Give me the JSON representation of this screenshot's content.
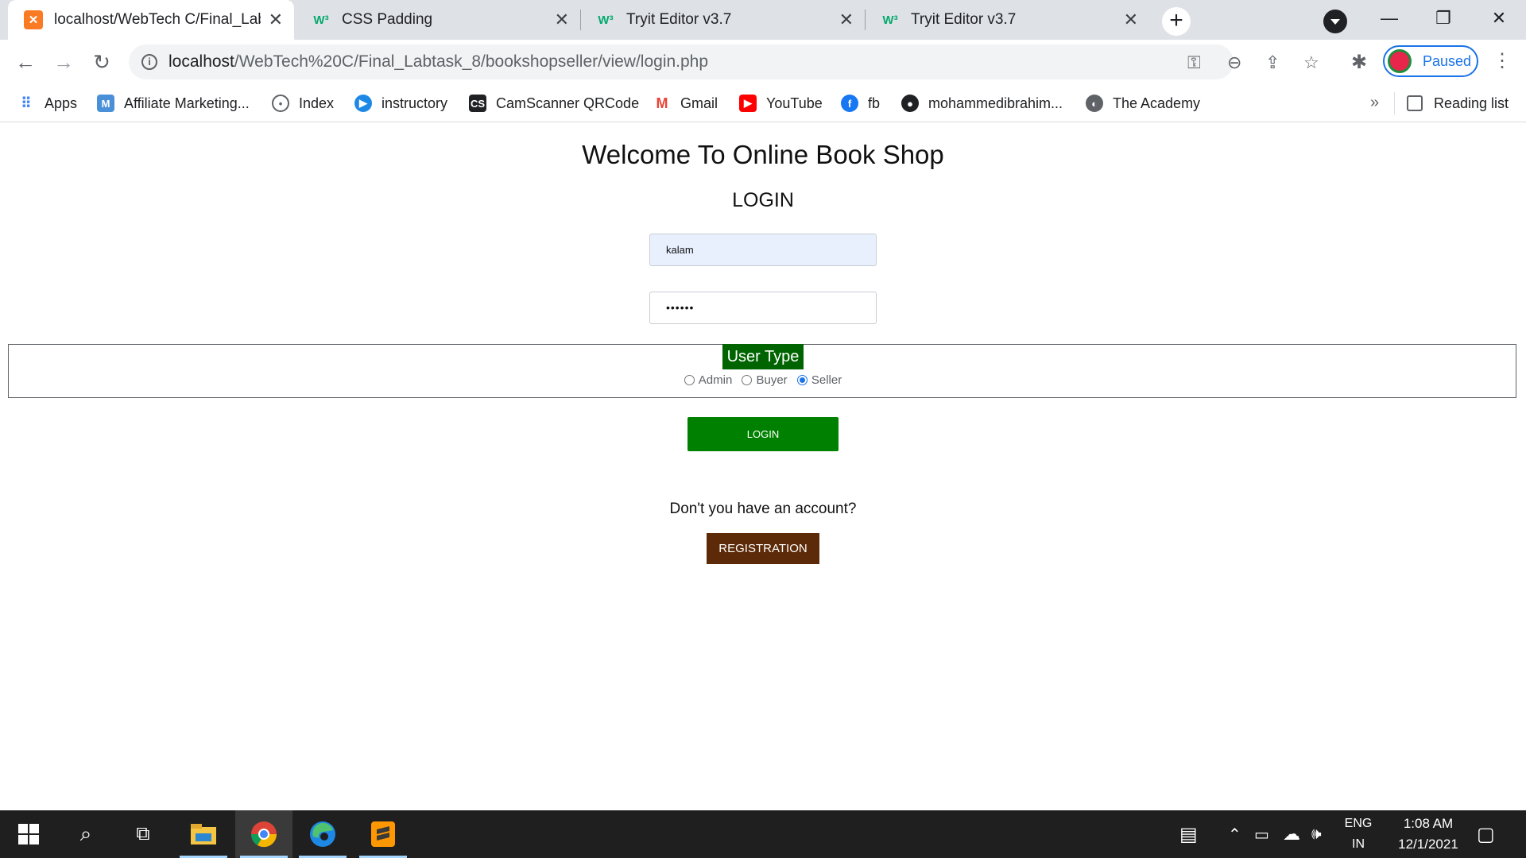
{
  "browser": {
    "tabs": [
      {
        "title": "localhost/WebTech C/Final_Labta",
        "active": true,
        "favicon": "xampp-icon"
      },
      {
        "title": "CSS Padding",
        "active": false,
        "favicon": "w3schools-icon"
      },
      {
        "title": "Tryit Editor v3.7",
        "active": false,
        "favicon": "w3schools-icon"
      },
      {
        "title": "Tryit Editor v3.7",
        "active": false,
        "favicon": "w3schools-icon"
      }
    ],
    "url_host": "localhost",
    "url_path": "/WebTech%20C/Final_Labtask_8/bookshopseller/view/login.php",
    "profile_label": "Paused",
    "bookmarks": [
      "Apps",
      "Affiliate Marketing...",
      "Index",
      "instructory",
      "CamScanner QRCode",
      "Gmail",
      "YouTube",
      "fb",
      "mohammedibrahim...",
      "The Academy"
    ],
    "reading_list": "Reading list"
  },
  "page": {
    "title": "Welcome To Online Book Shop",
    "login_heading": "LOGIN",
    "username_value": "kalam",
    "password_value": "••••••",
    "user_type_legend": "User Type",
    "user_types": [
      {
        "label": "Admin",
        "checked": false
      },
      {
        "label": "Buyer",
        "checked": false
      },
      {
        "label": "Seller",
        "checked": true
      }
    ],
    "login_button": "LOGIN",
    "account_question": "Don't you have an account?",
    "registration_button": "REGISTRATION"
  },
  "colors": {
    "legend_bg": "#006400",
    "login_btn": "#008000",
    "registration_btn": "#5c2a08"
  },
  "taskbar": {
    "language": "ENG",
    "region": "IN",
    "time": "1:08 AM",
    "date": "12/1/2021"
  }
}
